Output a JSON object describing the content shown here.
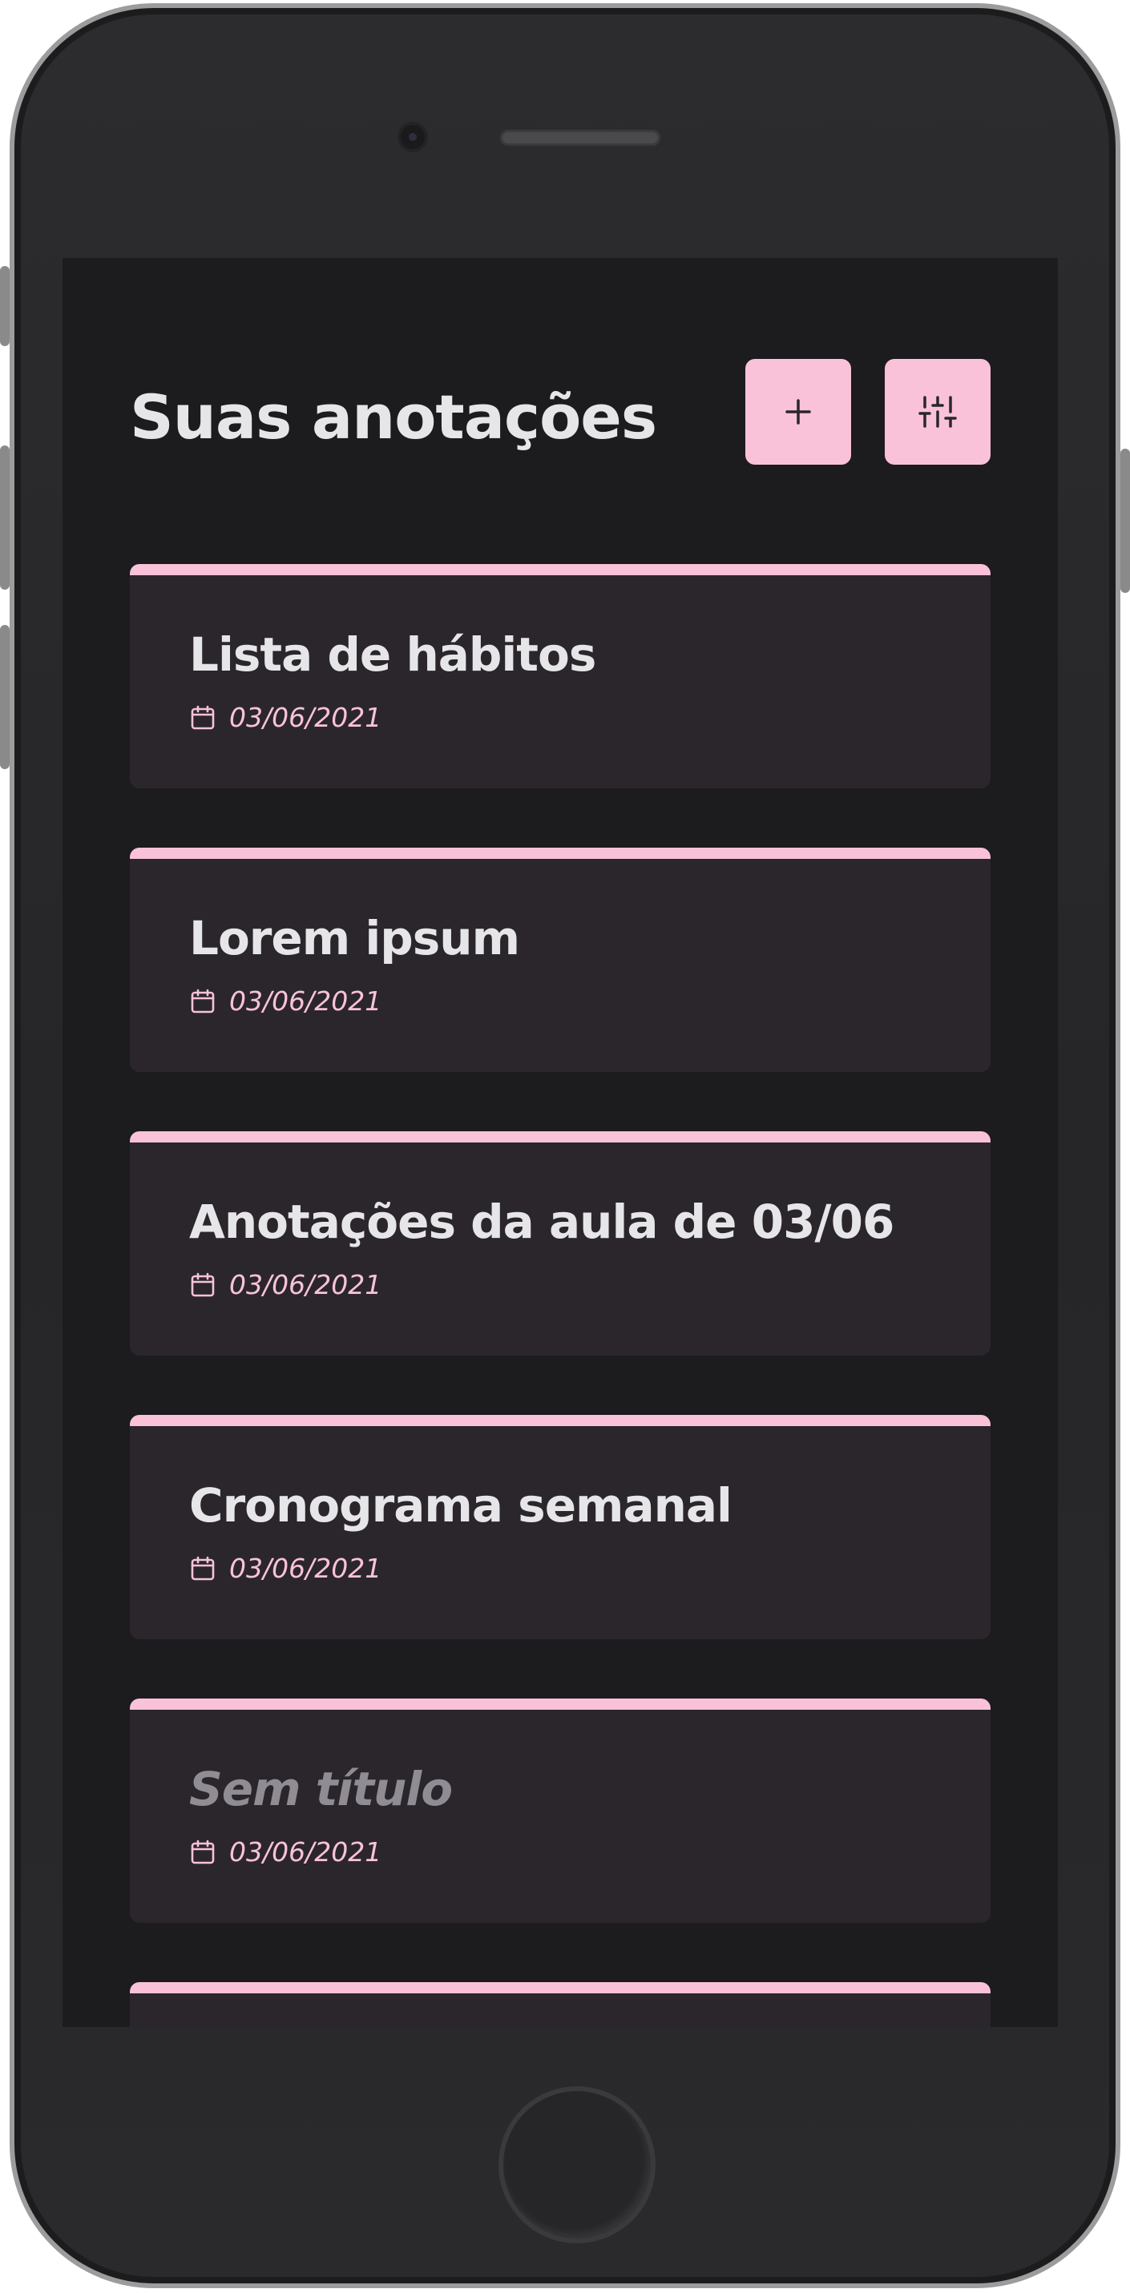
{
  "header": {
    "title": "Suas anotações",
    "add_label": "+",
    "filter_icon": "sliders-icon"
  },
  "colors": {
    "accent": "#f9c2d9",
    "background": "#1c1b1e",
    "card": "#2a262c",
    "text": "#e6e6e8",
    "muted": "#8f8c93"
  },
  "notes": [
    {
      "title": "Lista de hábitos",
      "date": "03/06/2021",
      "untitled": false
    },
    {
      "title": "Lorem ipsum",
      "date": "03/06/2021",
      "untitled": false
    },
    {
      "title": "Anotações da aula de 03/06",
      "date": "03/06/2021",
      "untitled": false
    },
    {
      "title": "Cronograma semanal",
      "date": "03/06/2021",
      "untitled": false
    },
    {
      "title": "Sem título",
      "date": "03/06/2021",
      "untitled": true
    },
    {
      "title": "",
      "date": "",
      "untitled": false
    }
  ]
}
